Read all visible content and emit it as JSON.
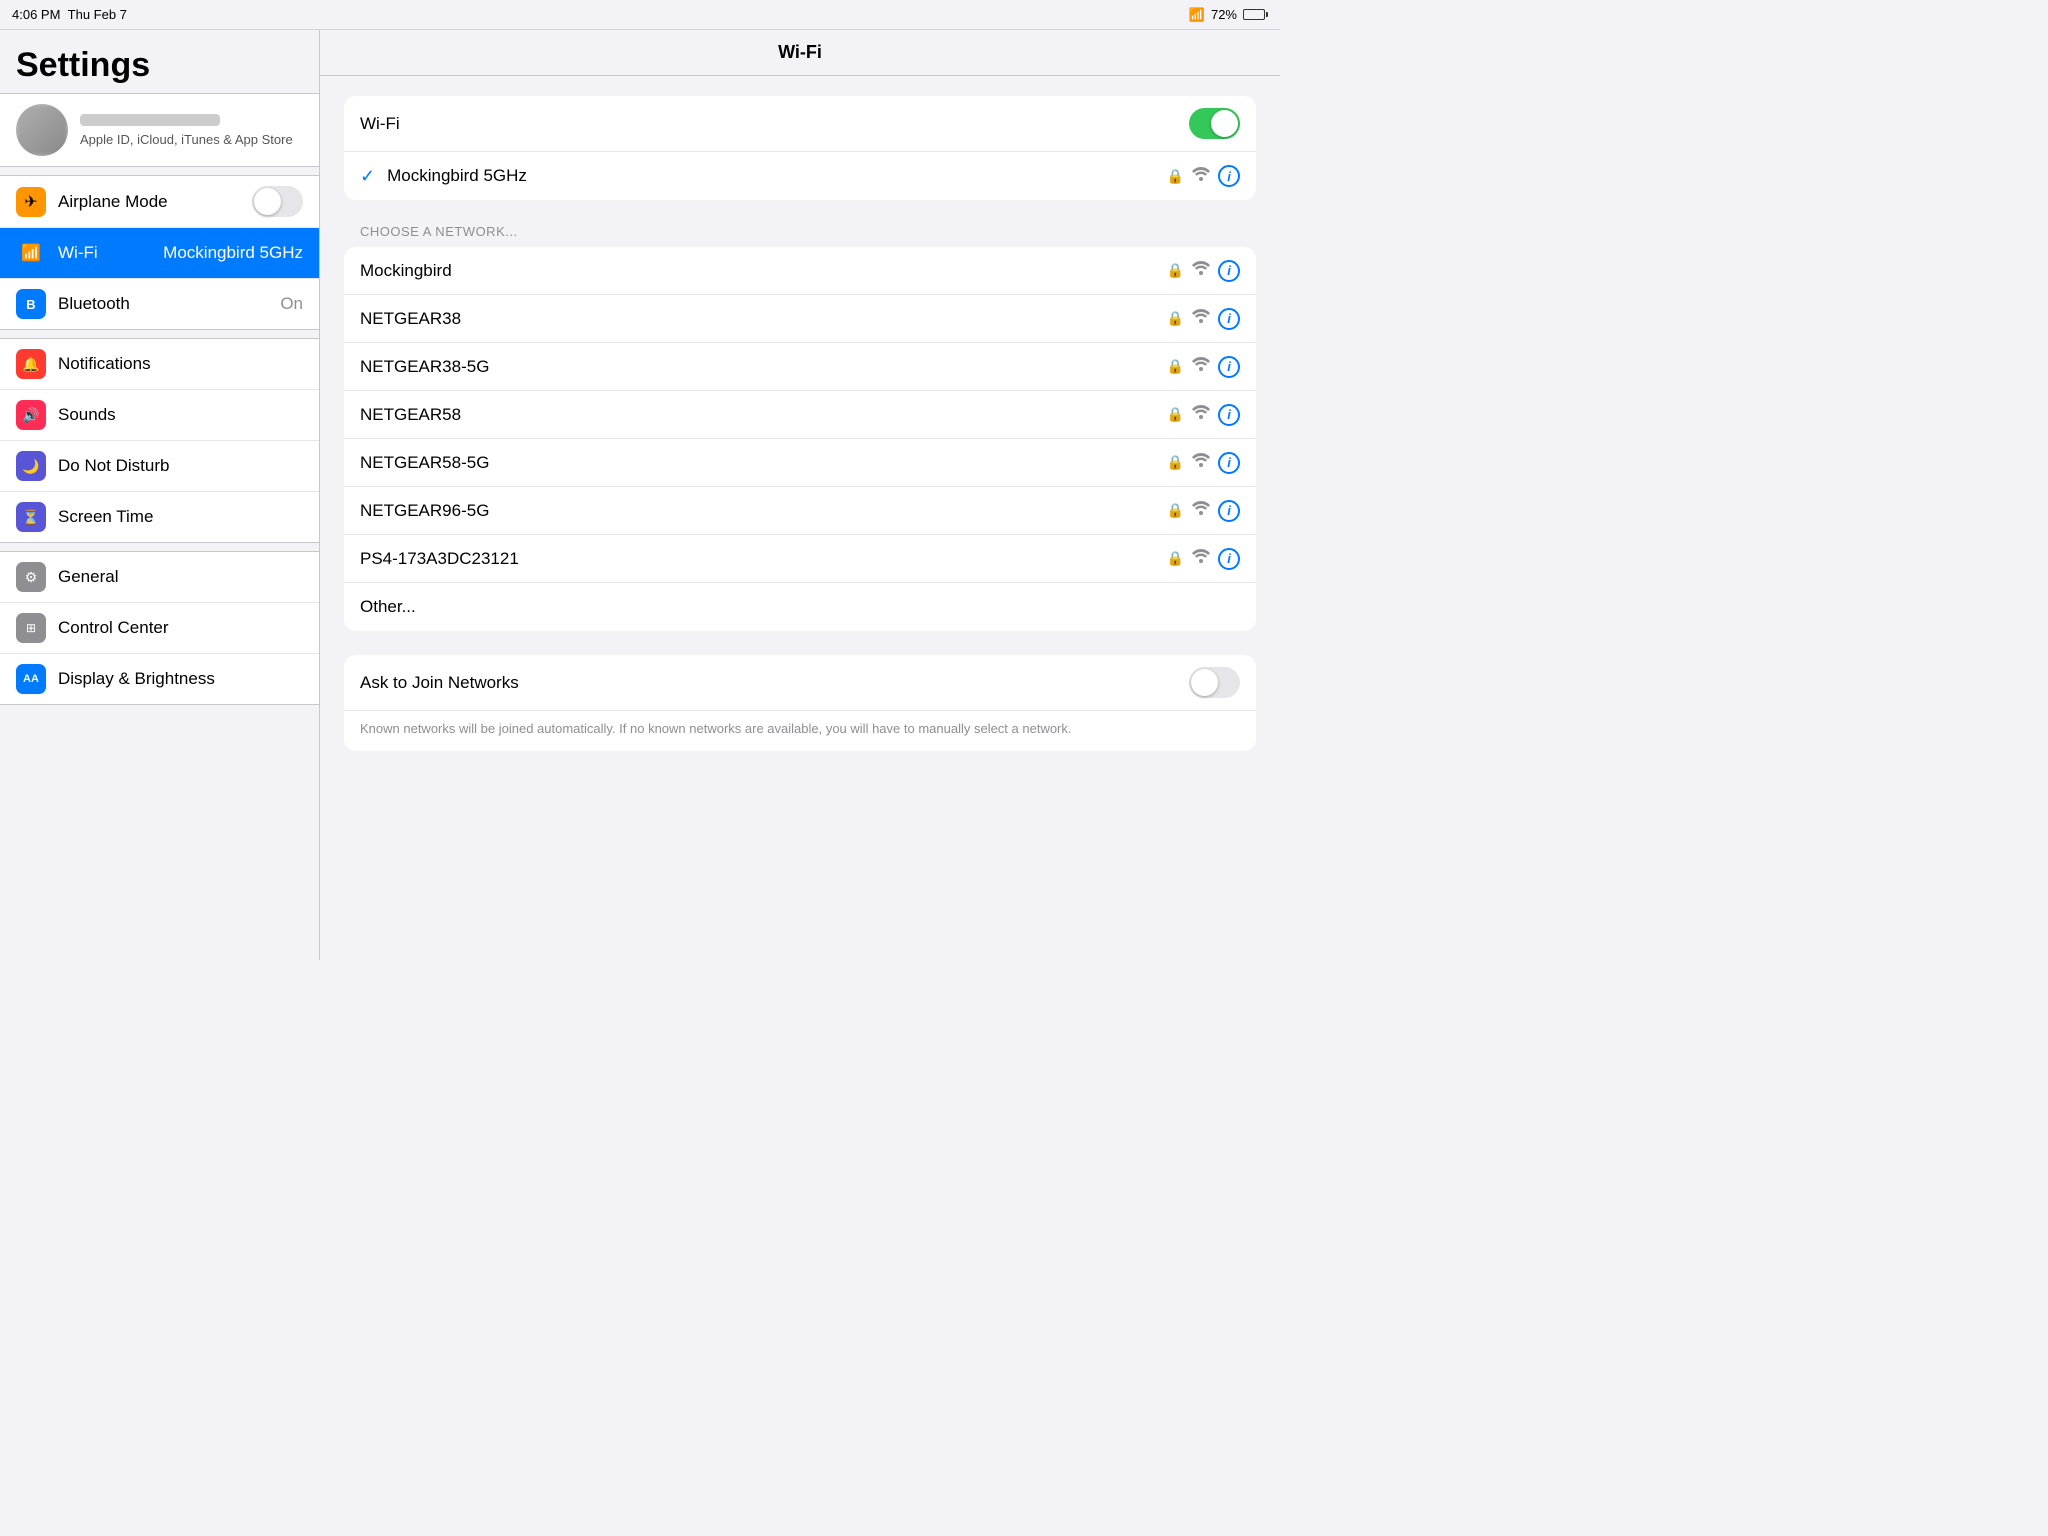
{
  "statusBar": {
    "time": "4:06 PM",
    "date": "Thu Feb 7",
    "battery": "72%"
  },
  "sidebar": {
    "title": "Settings",
    "account": {
      "subtitle": "Apple ID, iCloud, iTunes & App Store"
    },
    "groups": [
      {
        "items": [
          {
            "id": "airplane",
            "label": "Airplane Mode",
            "iconClass": "icon-orange",
            "iconSymbol": "✈",
            "hasToggle": true,
            "toggleOn": false
          },
          {
            "id": "wifi",
            "label": "Wi-Fi",
            "iconClass": "icon-blue",
            "iconSymbol": "📶",
            "value": "Mockingbird 5GHz",
            "active": true
          },
          {
            "id": "bluetooth",
            "label": "Bluetooth",
            "iconClass": "icon-blue-dark",
            "iconSymbol": "🔵",
            "value": "On"
          }
        ]
      },
      {
        "items": [
          {
            "id": "notifications",
            "label": "Notifications",
            "iconClass": "icon-red",
            "iconSymbol": "🔔"
          },
          {
            "id": "sounds",
            "label": "Sounds",
            "iconClass": "icon-pink",
            "iconSymbol": "🔊"
          },
          {
            "id": "donotdisturb",
            "label": "Do Not Disturb",
            "iconClass": "icon-indigo",
            "iconSymbol": "🌙"
          },
          {
            "id": "screentime",
            "label": "Screen Time",
            "iconClass": "icon-purple",
            "iconSymbol": "⏳"
          }
        ]
      },
      {
        "items": [
          {
            "id": "general",
            "label": "General",
            "iconClass": "icon-gray",
            "iconSymbol": "⚙"
          },
          {
            "id": "controlcenter",
            "label": "Control Center",
            "iconClass": "icon-gray",
            "iconSymbol": "⊞"
          },
          {
            "id": "displaybrightness",
            "label": "Display & Brightness",
            "iconClass": "icon-blue",
            "iconSymbol": "AA"
          }
        ]
      }
    ]
  },
  "content": {
    "title": "Wi-Fi",
    "wifiToggle": {
      "label": "Wi-Fi",
      "on": true
    },
    "connectedNetwork": {
      "name": "Mockingbird 5GHz"
    },
    "sectionLabel": "CHOOSE A NETWORK...",
    "networks": [
      {
        "name": "Mockingbird"
      },
      {
        "name": "NETGEAR38"
      },
      {
        "name": "NETGEAR38-5G"
      },
      {
        "name": "NETGEAR58"
      },
      {
        "name": "NETGEAR58-5G"
      },
      {
        "name": "NETGEAR96-5G"
      },
      {
        "name": "PS4-173A3DC23121"
      },
      {
        "name": "Other..."
      }
    ],
    "askToJoin": {
      "label": "Ask to Join Networks",
      "on": false,
      "description": "Known networks will be joined automatically. If no known networks are available, you will have to manually select a network."
    }
  }
}
